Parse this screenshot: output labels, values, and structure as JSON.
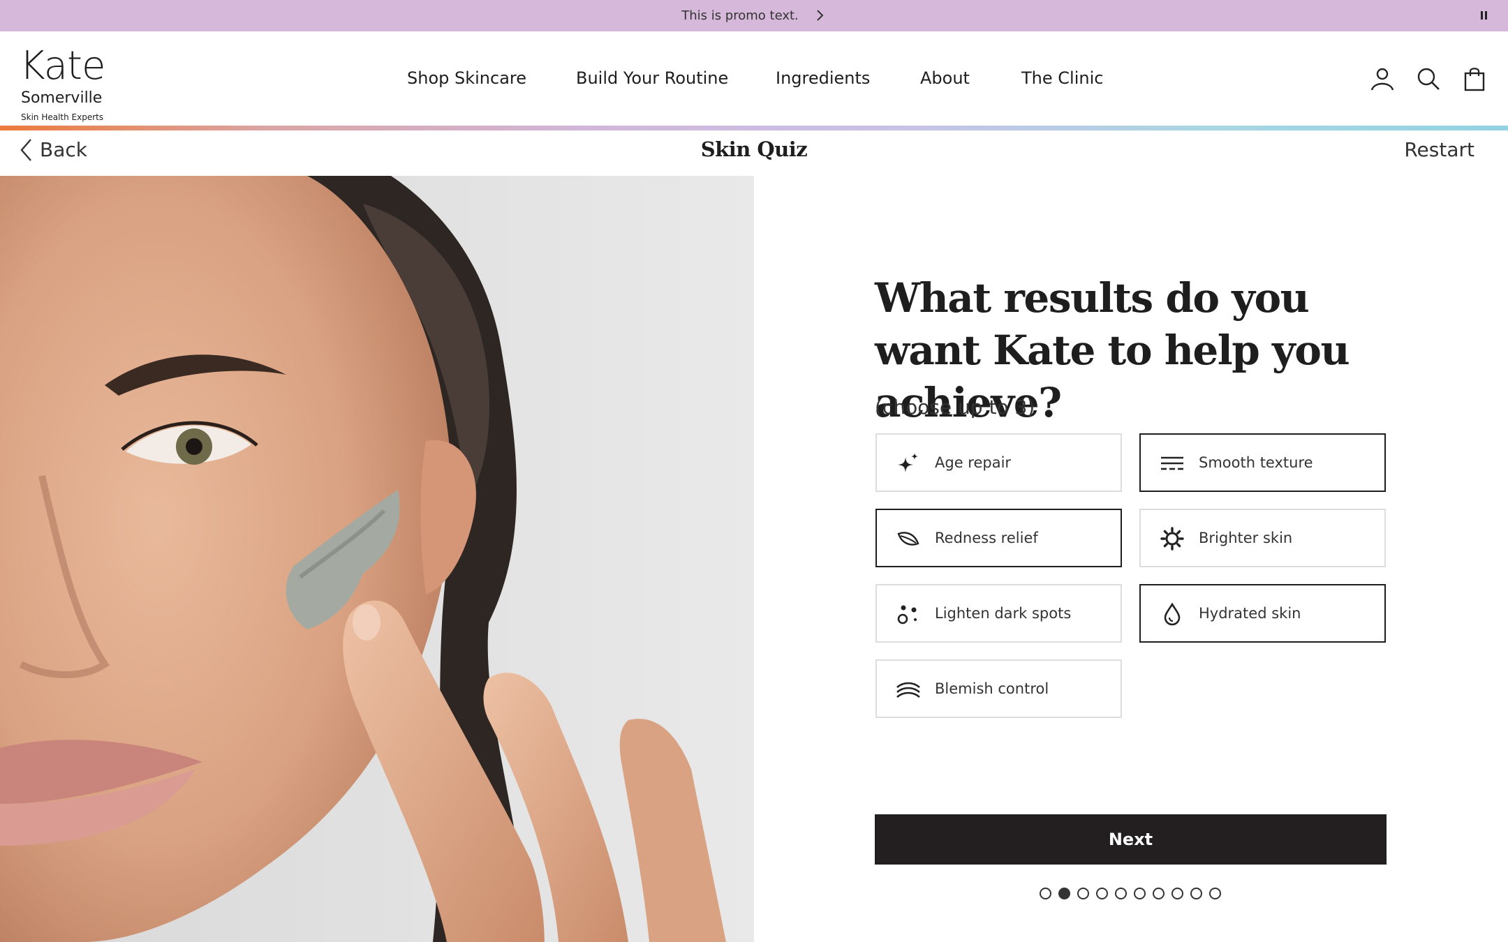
{
  "promo": {
    "text": "This is promo text."
  },
  "brand": {
    "name": "Kate",
    "name2": "Somerville",
    "tagline": "Skin Health Experts"
  },
  "nav": {
    "items": [
      {
        "label": "Shop Skincare"
      },
      {
        "label": "Build Your Routine"
      },
      {
        "label": "Ingredients"
      },
      {
        "label": "About"
      },
      {
        "label": "The Clinic"
      }
    ]
  },
  "header_icons": [
    "account-icon",
    "search-icon",
    "shopping-bag-icon"
  ],
  "quiz_bar": {
    "back": "Back",
    "title": "Skin Quiz",
    "restart": "Restart"
  },
  "question": {
    "title": "What results do you want Kate to help you achieve?",
    "hint": "(choose up to 3)"
  },
  "options": [
    {
      "label": "Age repair",
      "icon": "sparkle-icon",
      "selected": false
    },
    {
      "label": "Smooth texture",
      "icon": "lines-icon",
      "selected": true
    },
    {
      "label": "Redness relief",
      "icon": "leaf-icon",
      "selected": true
    },
    {
      "label": "Brighter skin",
      "icon": "sun-icon",
      "selected": false
    },
    {
      "label": "Lighten dark spots",
      "icon": "dots-icon",
      "selected": false
    },
    {
      "label": "Hydrated skin",
      "icon": "droplet-icon",
      "selected": true
    },
    {
      "label": "Blemish control",
      "icon": "arcs-icon",
      "selected": false
    }
  ],
  "next_label": "Next",
  "progress": {
    "current_step": 2,
    "total_steps": 10
  },
  "colors": {
    "promo_bg": "#d6b8da",
    "button_bg": "#231f20",
    "gradient": [
      "#ec7a3b",
      "#d1b6dc",
      "#92d2e3"
    ]
  }
}
